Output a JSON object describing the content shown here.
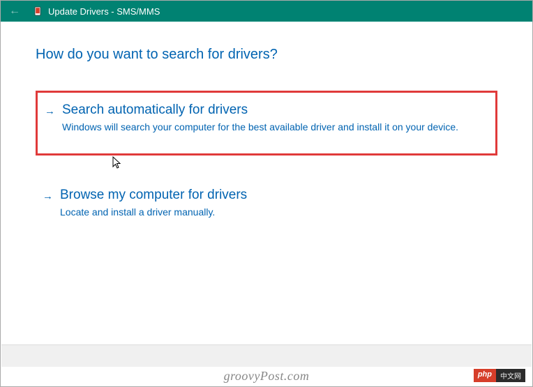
{
  "titlebar": {
    "title": "Update Drivers - SMS/MMS"
  },
  "heading": "How do you want to search for drivers?",
  "options": [
    {
      "title": "Search automatically for drivers",
      "desc": "Windows will search your computer for the best available driver and install it on your device."
    },
    {
      "title": "Browse my computer for drivers",
      "desc": "Locate and install a driver manually."
    }
  ],
  "watermark": "groovyPost.com",
  "badge": {
    "left": "php",
    "right": "中文网"
  }
}
